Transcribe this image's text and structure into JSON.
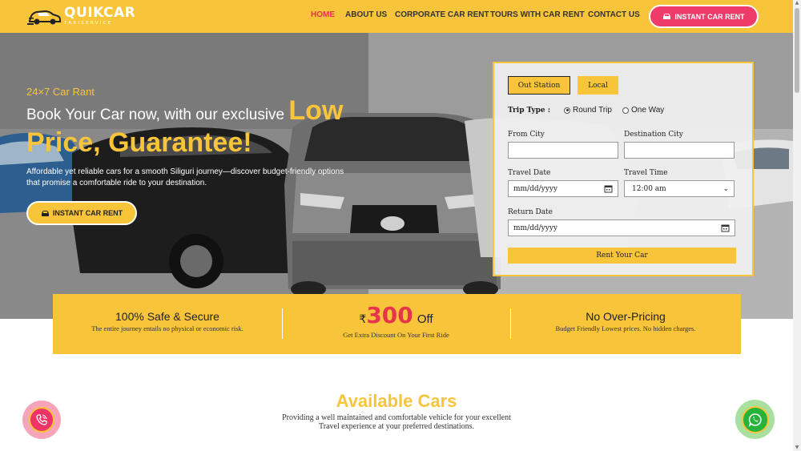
{
  "brand": {
    "name": "QUIKCAR",
    "tagline": "TAXISERVICE"
  },
  "nav": {
    "items": [
      "HOME",
      "ABOUT US",
      "CORPORATE CAR RENT",
      "TOURS WITH CAR RENT",
      "CONTACT US"
    ],
    "active": "HOME",
    "cta_label": "INSTANT CAR RENT"
  },
  "hero": {
    "tag": "24×7 Car Rant",
    "headline_prefix": "Book Your Car now, with our exclusive ",
    "headline_highlight": "Low Price, Guarantee!",
    "description": "Affordable yet reliable cars for a smooth Siliguri journey—discover budget-friendly options that promise a comfortable ride to your destination.",
    "button_label": "INSTANT CAR RENT"
  },
  "booking_form": {
    "tabs": [
      "Out Station",
      "Local"
    ],
    "active_tab": "Out Station",
    "trip_type_label": "Trip Type :",
    "trip_options": [
      "Round Trip",
      "One Way"
    ],
    "selected_trip": "Round Trip",
    "from_city_label": "From City",
    "from_city_value": "",
    "destination_city_label": "Destination City",
    "destination_city_value": "",
    "travel_date_label": "Travel Date",
    "travel_date_placeholder": "mm/dd/yyyy",
    "travel_time_label": "Travel Time",
    "travel_time_value": "12:00 am",
    "return_date_label": "Return Date",
    "return_date_placeholder": "mm/dd/yyyy",
    "submit_label": "Rent Your Car"
  },
  "features": [
    {
      "title": "100% Safe & Secure",
      "subtitle": "The entire journey entails no physical or economic risk."
    },
    {
      "currency": "₹",
      "amount": "300",
      "suffix": "Off",
      "subtitle": "Get Extra Discount On Your First Ride"
    },
    {
      "title": "No Over-Pricing",
      "subtitle": "Budget Friendly Lowest prices. No hidden charges."
    }
  ],
  "available_cars": {
    "title": "Available Cars",
    "subtitle_line1": "Providing a well maintained and comfortable vehicle for your excellent",
    "subtitle_line2": "Travel experience at your preferred destinations."
  },
  "colors": {
    "brand_yellow": "#f7c43a",
    "accent_pink": "#ef3b6a",
    "whatsapp_green": "#25b33a"
  },
  "icons": {
    "call": "phone-call-icon",
    "whatsapp": "whatsapp-icon",
    "car": "car-icon",
    "calendar": "calendar-icon"
  }
}
